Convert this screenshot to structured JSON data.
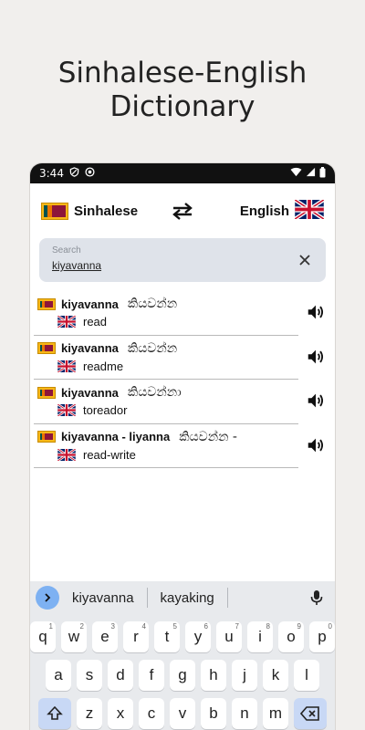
{
  "promo": {
    "title_line1": "Sinhalese-English",
    "title_line2": "Dictionary"
  },
  "status_bar": {
    "time": "3:44"
  },
  "languages": {
    "source": "Sinhalese",
    "target": "English"
  },
  "search": {
    "label": "Search",
    "value": "kiyavanna"
  },
  "results": [
    {
      "word": "kiyavanna",
      "sinhala": "කියවන්න",
      "translation": "read"
    },
    {
      "word": "kiyavanna",
      "sinhala": "කියවන්න",
      "translation": "readme"
    },
    {
      "word": "kiyavanna",
      "sinhala": "කියවන්නා",
      "translation": "toreador"
    },
    {
      "word": "kiyavanna - liyanna",
      "sinhala": "කියවන්න -",
      "translation": "read-write"
    }
  ],
  "keyboard": {
    "suggestions": [
      "kiyavanna",
      "kayaking"
    ],
    "row1": [
      {
        "k": "q",
        "n": "1"
      },
      {
        "k": "w",
        "n": "2"
      },
      {
        "k": "e",
        "n": "3"
      },
      {
        "k": "r",
        "n": "4"
      },
      {
        "k": "t",
        "n": "5"
      },
      {
        "k": "y",
        "n": "6"
      },
      {
        "k": "u",
        "n": "7"
      },
      {
        "k": "i",
        "n": "8"
      },
      {
        "k": "o",
        "n": "9"
      },
      {
        "k": "p",
        "n": "0"
      }
    ],
    "row2": [
      "a",
      "s",
      "d",
      "f",
      "g",
      "h",
      "j",
      "k",
      "l"
    ],
    "row3": [
      "z",
      "x",
      "c",
      "v",
      "b",
      "n",
      "m"
    ]
  },
  "colors": {
    "background": "#f1efed",
    "search_bg": "#dfe3ea",
    "keyboard_bg": "#e8eaed",
    "accent": "#7db1f2"
  }
}
